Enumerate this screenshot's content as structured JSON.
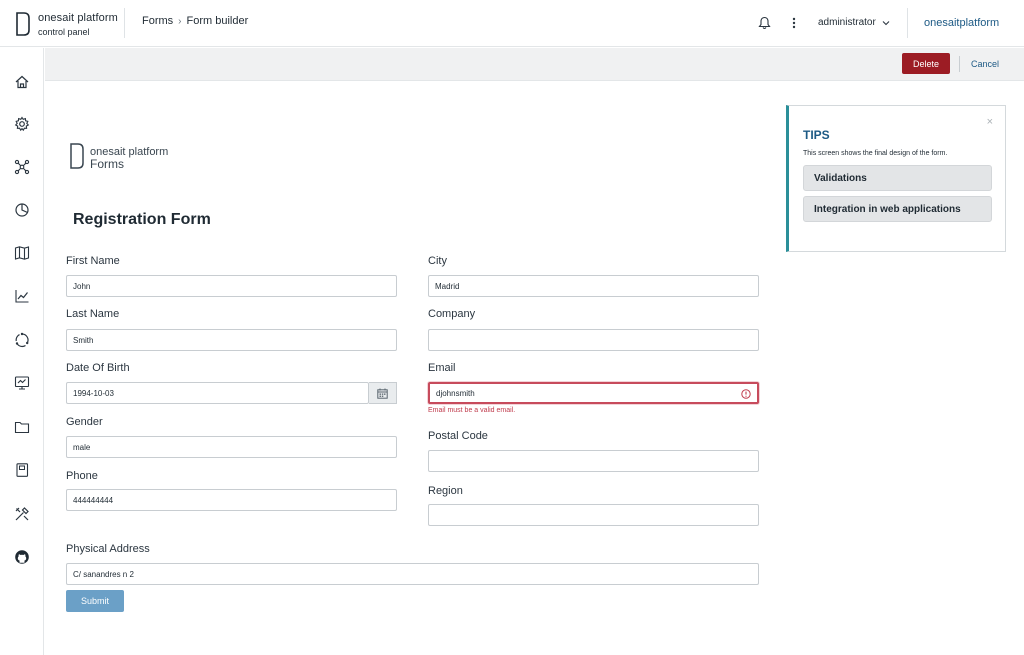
{
  "header": {
    "app_name": "onesait platform",
    "app_sub": "control panel",
    "breadcrumb": [
      "Forms",
      "Form builder"
    ],
    "breadcrumb_separator": "›",
    "user": "administrator",
    "brand_link": "onesaitplatform",
    "icons": [
      "bell-icon",
      "more-vertical-icon",
      "chevron-down-icon"
    ]
  },
  "sidebar": {
    "items": [
      {
        "name": "home-icon"
      },
      {
        "name": "gear-icon"
      },
      {
        "name": "network-icon"
      },
      {
        "name": "pie-chart-icon"
      },
      {
        "name": "map-icon"
      },
      {
        "name": "line-chart-icon"
      },
      {
        "name": "cycle-icon"
      },
      {
        "name": "monitor-icon"
      },
      {
        "name": "folder-icon"
      },
      {
        "name": "book-icon"
      },
      {
        "name": "tools-icon"
      },
      {
        "name": "github-icon"
      }
    ]
  },
  "actionbar": {
    "delete_label": "Delete",
    "cancel_label": "Cancel",
    "delete_color": "#9c1c24"
  },
  "form": {
    "logo_name": "onesait platform",
    "logo_sub": "Forms",
    "title": "Registration Form",
    "fields": {
      "first_name": {
        "label": "First Name",
        "value": "John"
      },
      "last_name": {
        "label": "Last Name",
        "value": "Smith"
      },
      "dob": {
        "label": "Date Of Birth",
        "value": "1994-10-03"
      },
      "gender": {
        "label": "Gender",
        "value": "male"
      },
      "phone": {
        "label": "Phone",
        "value": "444444444"
      },
      "city": {
        "label": "City",
        "value": "Madrid"
      },
      "company": {
        "label": "Company",
        "value": ""
      },
      "email": {
        "label": "Email",
        "value": "djohnsmith",
        "error": "Email must be a valid email."
      },
      "postal_code": {
        "label": "Postal Code",
        "value": ""
      },
      "region": {
        "label": "Region",
        "value": ""
      },
      "address": {
        "label": "Physical Address",
        "value": "C/ sanandres n 2"
      }
    },
    "submit_label": "Submit",
    "submit_color": "#6ba0c7",
    "error_color": "#c03b4c"
  },
  "tips": {
    "title": "TIPS",
    "text": "This screen shows the final design of the form.",
    "close": "×",
    "buttons": [
      "Validations",
      "Integration in web applications"
    ],
    "accent_color": "#2a8f99"
  }
}
